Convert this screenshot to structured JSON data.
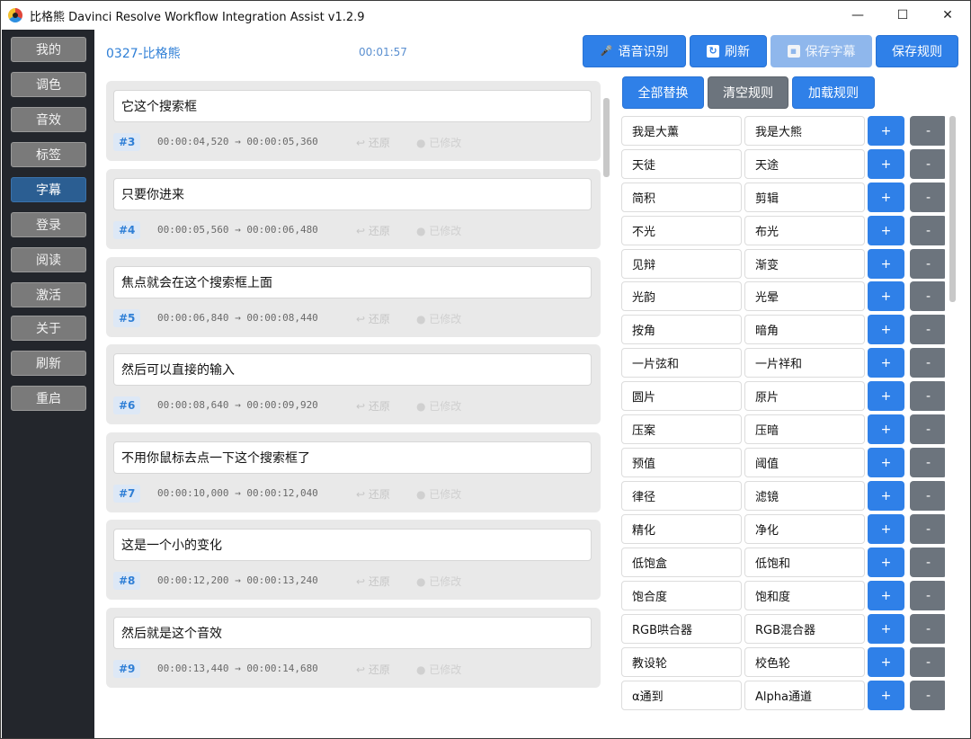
{
  "window": {
    "title": "比格熊 Davinci Resolve Workflow Integration Assist v1.2.9",
    "minimize": "—",
    "maximize": "☐",
    "close": "✕"
  },
  "sidebar": {
    "items": [
      {
        "label": "我的",
        "active": false
      },
      {
        "label": "调色",
        "active": false
      },
      {
        "label": "音效",
        "active": false
      },
      {
        "label": "标签",
        "active": false
      },
      {
        "label": "字幕",
        "active": true
      },
      {
        "label": "登录",
        "active": false
      },
      {
        "label": "阅读",
        "active": false
      },
      {
        "label": "激活",
        "active": false
      },
      {
        "label": "关于",
        "active": false
      },
      {
        "label": "刷新",
        "active": false
      },
      {
        "label": "重启",
        "active": false
      }
    ]
  },
  "header": {
    "project": "0327-比格熊",
    "timecode": "00:01:57"
  },
  "toolbar": {
    "speech_label": "语音识别",
    "refresh_label": "刷新",
    "save_subtitles_label": "保存字幕",
    "save_rules_label": "保存规则"
  },
  "rule_toolbar": {
    "replace_all_label": "全部替换",
    "clear_rules_label": "清空规则",
    "load_rules_label": "加载规则"
  },
  "subtitles": [
    {
      "num": "#3",
      "text": "它这个搜索框",
      "time": "00:00:04,520 → 00:00:05,360",
      "restore": "↩ 还原",
      "modified": "● 已修改"
    },
    {
      "num": "#4",
      "text": "只要你进来",
      "time": "00:00:05,560 → 00:00:06,480",
      "restore": "↩ 还原",
      "modified": "● 已修改"
    },
    {
      "num": "#5",
      "text": "焦点就会在这个搜索框上面",
      "time": "00:00:06,840 → 00:00:08,440",
      "restore": "↩ 还原",
      "modified": "● 已修改"
    },
    {
      "num": "#6",
      "text": "然后可以直接的输入",
      "time": "00:00:08,640 → 00:00:09,920",
      "restore": "↩ 还原",
      "modified": "● 已修改"
    },
    {
      "num": "#7",
      "text": "不用你鼠标去点一下这个搜索框了",
      "time": "00:00:10,000 → 00:00:12,040",
      "restore": "↩ 还原",
      "modified": "● 已修改"
    },
    {
      "num": "#8",
      "text": "这是一个小的变化",
      "time": "00:00:12,200 → 00:00:13,240",
      "restore": "↩ 还原",
      "modified": "● 已修改"
    },
    {
      "num": "#9",
      "text": "然后就是这个音效",
      "time": "00:00:13,440 → 00:00:14,680",
      "restore": "↩ 还原",
      "modified": "● 已修改"
    }
  ],
  "rules": [
    {
      "from": "我是大薰",
      "to": "我是大熊"
    },
    {
      "from": "天徒",
      "to": "天途"
    },
    {
      "from": "简积",
      "to": "剪辑"
    },
    {
      "from": "不光",
      "to": "布光"
    },
    {
      "from": "见辩",
      "to": "渐变"
    },
    {
      "from": "光韵",
      "to": "光晕"
    },
    {
      "from": "按角",
      "to": "暗角"
    },
    {
      "from": "一片弦和",
      "to": "一片祥和"
    },
    {
      "from": "圆片",
      "to": "原片"
    },
    {
      "from": "压案",
      "to": "压暗"
    },
    {
      "from": "预值",
      "to": "阈值"
    },
    {
      "from": "律径",
      "to": "滤镜"
    },
    {
      "from": "精化",
      "to": "净化"
    },
    {
      "from": "低饱盒",
      "to": "低饱和"
    },
    {
      "from": "饱合度",
      "to": "饱和度"
    },
    {
      "from": "RGB哄合器",
      "to": "RGB混合器"
    },
    {
      "from": "教设轮",
      "to": "校色轮"
    },
    {
      "from": "α通到",
      "to": "Alpha通道"
    }
  ],
  "rule_buttons": {
    "add": "+",
    "remove": "-"
  },
  "colors": {
    "accent": "#2f80e8",
    "sidebar_bg": "#23262c",
    "active_item": "#2b5e92",
    "gray_button": "#6c747d"
  }
}
